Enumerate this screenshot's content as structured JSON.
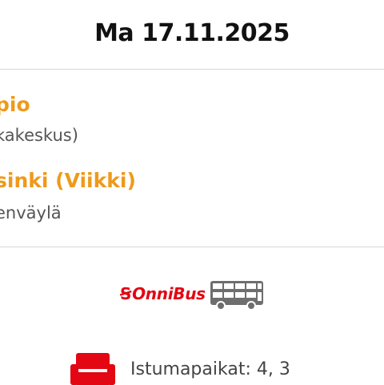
{
  "trip": {
    "date": "Ma 17.11.2025",
    "origin": {
      "city": "pio",
      "stop": "kakeskus)"
    },
    "destination": {
      "city": "sinki (Viikki)",
      "stop": "enväylä"
    }
  },
  "operator": {
    "logo_mark": "Ꞩ",
    "name": "OnniBus",
    "brand_color": "#e30613",
    "icon": "double-decker-bus-icon"
  },
  "seats": {
    "icon": "seat-icon",
    "label": "Istumapaikat: 4, 3",
    "icon_color": "#e30613"
  },
  "colors": {
    "city_accent": "#ee9a1a",
    "divider": "#d6d6d6"
  }
}
